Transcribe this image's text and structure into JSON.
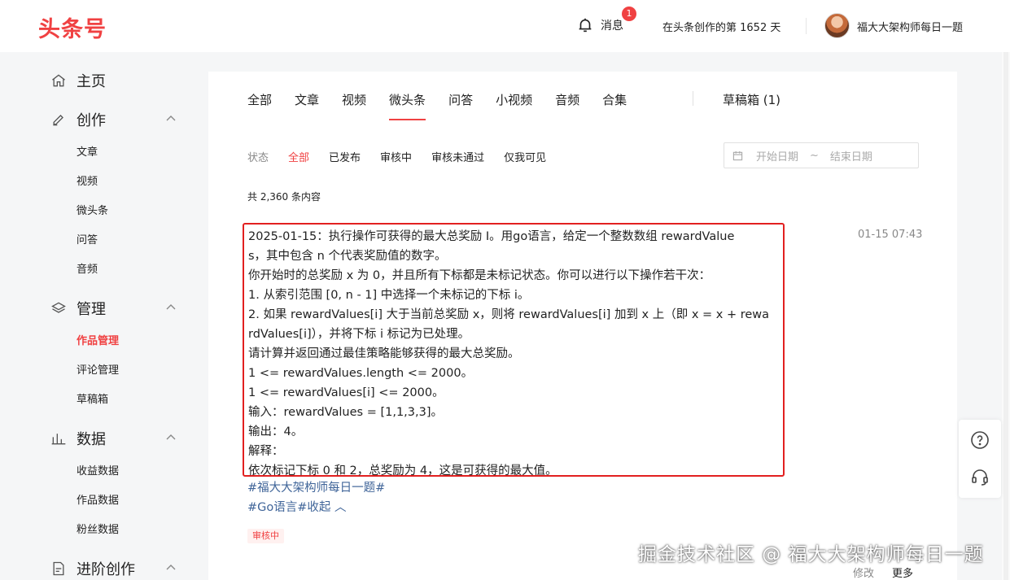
{
  "header": {
    "logo": "头条号",
    "messages_label": "消息",
    "messages_badge": "1",
    "days_text": "在头条创作的第 1652 天",
    "username": "福大大架构师每日一题"
  },
  "sidebar": {
    "groups": [
      {
        "label": "主页",
        "icon": "home-icon"
      },
      {
        "label": "创作",
        "icon": "pen-icon",
        "items": [
          "文章",
          "视频",
          "微头条",
          "问答",
          "音频"
        ]
      },
      {
        "label": "管理",
        "icon": "layers-icon",
        "items": [
          "作品管理",
          "评论管理",
          "草稿箱"
        ],
        "active_item": "作品管理"
      },
      {
        "label": "数据",
        "icon": "bar-chart-icon",
        "items": [
          "收益数据",
          "作品数据",
          "粉丝数据"
        ]
      },
      {
        "label": "进阶创作",
        "icon": "edit-doc-icon"
      }
    ]
  },
  "tabs": {
    "items": [
      "全部",
      "文章",
      "视频",
      "微头条",
      "问答",
      "小视频",
      "音频",
      "合集"
    ],
    "active": "微头条",
    "drafts": "草稿箱 (1)"
  },
  "filters": {
    "label": "状态",
    "items": [
      "全部",
      "已发布",
      "审核中",
      "审核未通过",
      "仅我可见"
    ],
    "active": "全部",
    "date_start_placeholder": "开始日期",
    "date_sep": "~",
    "date_end_placeholder": "结束日期"
  },
  "count_text": "共 2,360 条内容",
  "post": {
    "time": "01-15 07:43",
    "lines": [
      "2025-01-15：执行操作可获得的最大总奖励 Ⅰ。用go语言，给定一个整数数组 rewardValue",
      "s，其中包含 n 个代表奖励值的数字。",
      "你开始时的总奖励 x 为 0，并且所有下标都是未标记状态。你可以进行以下操作若干次：",
      "1. 从索引范围 [0, n - 1] 中选择一个未标记的下标 i。",
      "2. 如果 rewardValues[i] 大于当前总奖励 x，则将 rewardValues[i] 加到 x 上（即 x = x + rewa",
      "rdValues[i]），并将下标 i 标记为已处理。",
      "请计算并返回通过最佳策略能够获得的最大总奖励。",
      "1 <= rewardValues.length <= 2000。",
      "1 <= rewardValues[i] <= 2000。",
      "输入：rewardValues = [1,1,3,3]。",
      "输出：4。",
      "解释：",
      "依次标记下标 0 和 2，总奖励为 4，这是可获得的最大值。"
    ],
    "hashtag1": "#福大大架构师每日一题#",
    "hashtag2": "#Go语言#收起",
    "collapse_glyph": "︿",
    "status": "审核中",
    "action_edit": "修改",
    "action_more": "更多"
  },
  "watermark": "掘金技术社区 @ 福大大架构师每日一题",
  "colors": {
    "accent": "#f04142",
    "link": "#406599",
    "highlight_box": "#e22020"
  }
}
